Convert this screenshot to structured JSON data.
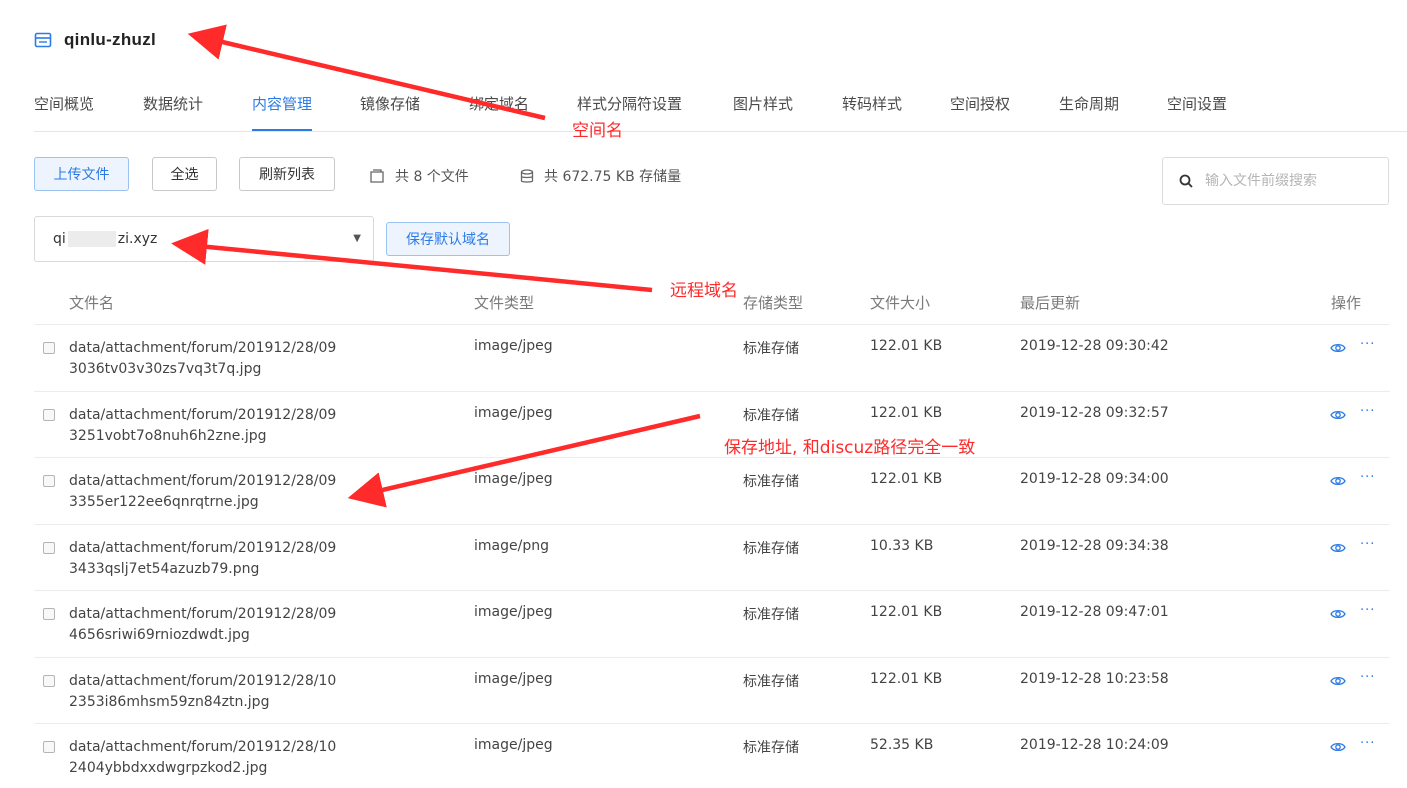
{
  "bucket": {
    "name": "qinlu-zhuzl",
    "icon": "bucket-icon"
  },
  "tabs": [
    {
      "label": "空间概览"
    },
    {
      "label": "数据统计"
    },
    {
      "label": "内容管理",
      "active": true
    },
    {
      "label": "镜像存储"
    },
    {
      "label": "绑定域名"
    },
    {
      "label": "样式分隔符设置"
    },
    {
      "label": "图片样式"
    },
    {
      "label": "转码样式"
    },
    {
      "label": "空间授权"
    },
    {
      "label": "生命周期"
    },
    {
      "label": "空间设置"
    }
  ],
  "toolbar": {
    "upload_label": "上传文件",
    "select_all_label": "全选",
    "refresh_label": "刷新列表",
    "file_count": "共 8 个文件",
    "storage_total": "共 672.75 KB 存储量",
    "search_placeholder": "输入文件前缀搜索"
  },
  "domain": {
    "prefix": "qi",
    "suffix": "zi.xyz",
    "save_label": "保存默认域名"
  },
  "table": {
    "headers": {
      "name": "文件名",
      "type": "文件类型",
      "storage": "存储类型",
      "size": "文件大小",
      "updated": "最后更新",
      "actions": "操作"
    },
    "rows": [
      {
        "name1": "data/attachment/forum/201912/28/09",
        "name2": "3036tv03v30zs7vq3t7q.jpg",
        "type": "image/jpeg",
        "storage": "标准存储",
        "size": "122.01 KB",
        "updated": "2019-12-28 09:30:42"
      },
      {
        "name1": "data/attachment/forum/201912/28/09",
        "name2": "3251vobt7o8nuh6h2zne.jpg",
        "type": "image/jpeg",
        "storage": "标准存储",
        "size": "122.01 KB",
        "updated": "2019-12-28 09:32:57"
      },
      {
        "name1": "data/attachment/forum/201912/28/09",
        "name2": "3355er122ee6qnrqtrne.jpg",
        "type": "image/jpeg",
        "storage": "标准存储",
        "size": "122.01 KB",
        "updated": "2019-12-28 09:34:00"
      },
      {
        "name1": "data/attachment/forum/201912/28/09",
        "name2": "3433qslj7et54azuzb79.png",
        "type": "image/png",
        "storage": "标准存储",
        "size": "10.33 KB",
        "updated": "2019-12-28 09:34:38"
      },
      {
        "name1": "data/attachment/forum/201912/28/09",
        "name2": "4656sriwi69rniozdwdt.jpg",
        "type": "image/jpeg",
        "storage": "标准存储",
        "size": "122.01 KB",
        "updated": "2019-12-28 09:47:01"
      },
      {
        "name1": "data/attachment/forum/201912/28/10",
        "name2": "2353i86mhsm59zn84ztn.jpg",
        "type": "image/jpeg",
        "storage": "标准存储",
        "size": "122.01 KB",
        "updated": "2019-12-28 10:23:58"
      },
      {
        "name1": "data/attachment/forum/201912/28/10",
        "name2": "2404ybbdxxdwgrpzkod2.jpg",
        "type": "image/jpeg",
        "storage": "标准存储",
        "size": "52.35 KB",
        "updated": "2019-12-28 10:24:09"
      }
    ],
    "more_glyph": "···"
  },
  "annotations": {
    "bucket_name": "空间名",
    "remote_domain": "远程域名",
    "save_path": "保存地址, 和discuz路径完全一致"
  },
  "colors": {
    "accent": "#2c7be5",
    "annotation": "#ff2a2a"
  }
}
